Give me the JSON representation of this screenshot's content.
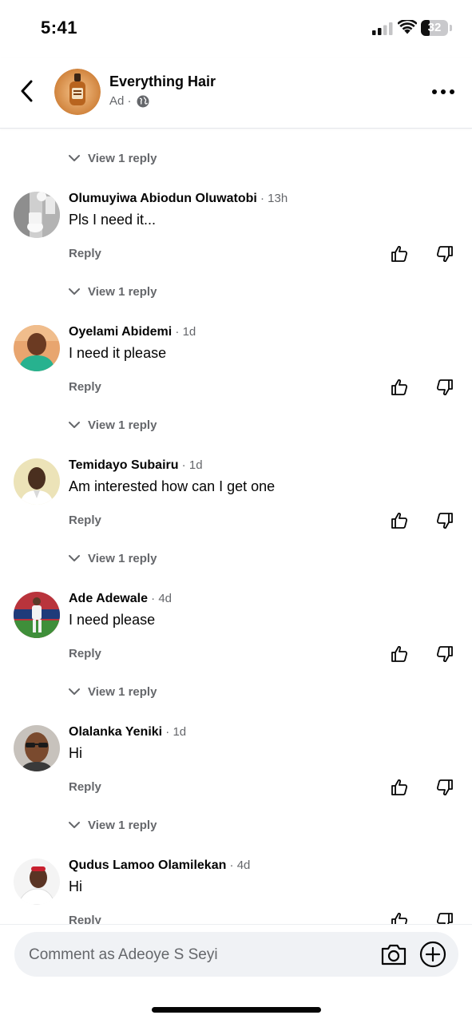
{
  "status_bar": {
    "time": "5:41",
    "battery": "32",
    "battery_level": 0.32
  },
  "header": {
    "page_name": "Everything Hair",
    "ad_label": "Ad ·",
    "avatar_icon": "serum-bottle-logo"
  },
  "view_reply_label": "View 1 reply",
  "top_view_reply": "View 1 reply",
  "comments": [
    {
      "name": "Olumuyiwa Abiodun Oluwatobi",
      "time": " · 13h",
      "text": "Pls I need it...",
      "reply": "Reply",
      "view_reply": "View 1 reply",
      "avatar": "bathroom-photo"
    },
    {
      "name": "Oyelami Abidemi",
      "time": " · 1d",
      "text": "I need it please",
      "reply": "Reply",
      "view_reply": "View 1 reply",
      "avatar": "man-green-shirt"
    },
    {
      "name": "Temidayo Subairu",
      "time": " · 1d",
      "text": "Am interested how can I get one",
      "reply": "Reply",
      "view_reply": "View 1 reply",
      "avatar": "man-portrait"
    },
    {
      "name": "Ade Adewale",
      "time": " · 4d",
      "text": "I need please",
      "reply": "Reply",
      "view_reply": "View 1 reply",
      "avatar": "footballer-photo"
    },
    {
      "name": "Olalanka Yeniki",
      "time": " · 1d",
      "text": "Hi",
      "reply": "Reply",
      "view_reply": "View 1 reply",
      "avatar": "man-sunglasses"
    },
    {
      "name": "Qudus Lamoo Olamilekan",
      "time": " · 4d",
      "text": "Hi",
      "reply": "Reply",
      "avatar": "man-white-shirt"
    }
  ],
  "composer": {
    "placeholder": "Comment as Adeoye S Seyi"
  },
  "colors": {
    "secondary_text": "#65676b",
    "composer_bg": "#f0f2f5",
    "primary_text": "#050505"
  }
}
